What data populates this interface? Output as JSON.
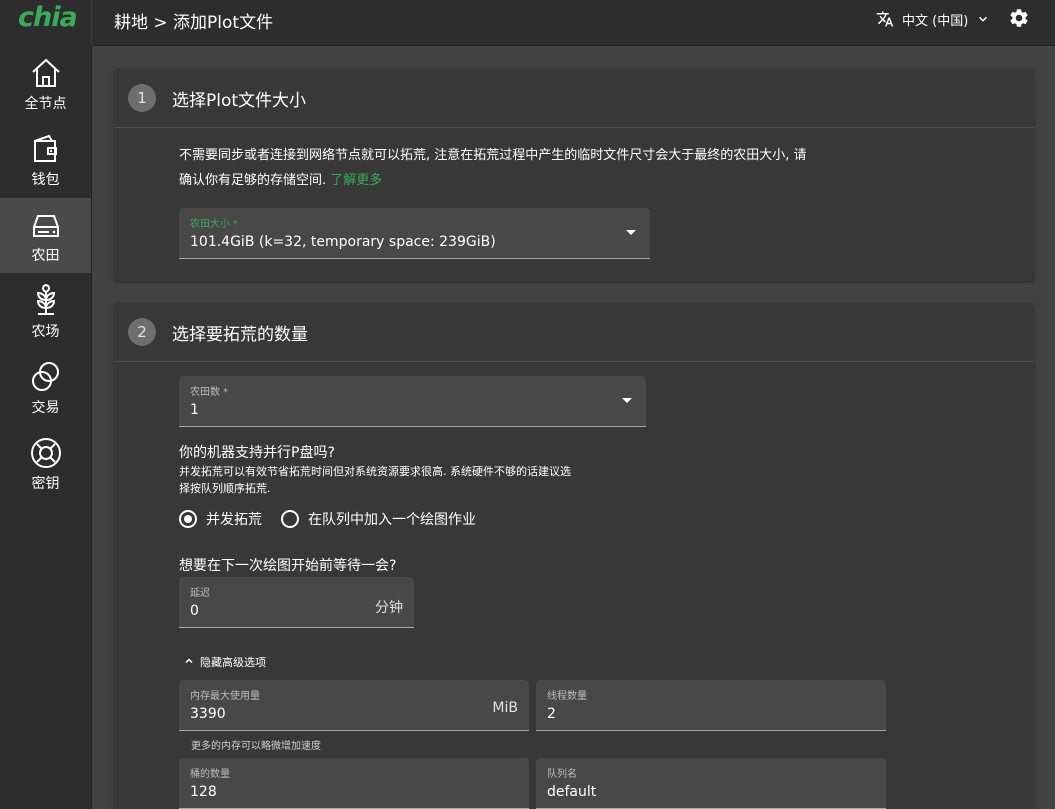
{
  "app": {
    "logo": "chia"
  },
  "header": {
    "breadcrumb": "耕地 > 添加Plot文件",
    "language": "中文 (中国)",
    "icons": [
      "translate-icon",
      "chevron-down-icon",
      "settings-icon"
    ]
  },
  "sidebar": {
    "items": [
      {
        "label": "全节点",
        "icon": "home-icon",
        "active": false
      },
      {
        "label": "钱包",
        "icon": "wallet-icon",
        "active": false
      },
      {
        "label": "农田",
        "icon": "hard-drive-icon",
        "active": true
      },
      {
        "label": "农场",
        "icon": "sprout-icon",
        "active": false
      },
      {
        "label": "交易",
        "icon": "trade-icon",
        "active": false
      },
      {
        "label": "密钥",
        "icon": "lifebuoy-icon",
        "active": false
      }
    ]
  },
  "step1": {
    "number": "1",
    "title": "选择Plot文件大小",
    "description_line1": "不需要同步或者连接到网络节点就可以拓荒, 注意在拓荒过程中产生的临时文件尺寸会大于最终的农田大小, 请",
    "description_line2": "确认你有足够的存储空间.",
    "learn_more": "了解更多",
    "plot_size": {
      "label": "农田大小 *",
      "value": "101.4GiB (k=32, temporary space: 239GiB)"
    }
  },
  "step2": {
    "number": "2",
    "title": "选择要拓荒的数量",
    "plot_count": {
      "label": "农田数 *",
      "value": "1"
    },
    "parallel_question": "你的机器支持并行P盘吗?",
    "parallel_hint_line1": "并发拓荒可以有效节省拓荒时间但对系统资源要求很高. 系统硬件不够的话建议选",
    "parallel_hint_line2": "择按队列顺序拓荒.",
    "options": [
      {
        "label": "并发拓荒",
        "checked": true
      },
      {
        "label": "在队列中加入一个绘图作业",
        "checked": false
      }
    ],
    "delay_question": "想要在下一次绘图开始前等待一会?",
    "delay": {
      "label": "延迟",
      "value": "0",
      "unit": "分钟"
    },
    "advanced_toggle": "隐藏高级选项",
    "memory": {
      "label": "内存最大使用量",
      "value": "3390",
      "unit": "MiB",
      "helper": "更多的内存可以略微增加速度"
    },
    "threads": {
      "label": "线程数量",
      "value": "2"
    },
    "buckets": {
      "label": "桶的数量",
      "value": "128"
    },
    "queue": {
      "label": "队列名",
      "value": "default"
    }
  },
  "colors": {
    "accent": "#3aac59",
    "background": "#424242",
    "sidebar": "#2d2d2d",
    "card": "#383838",
    "field": "#484848"
  }
}
